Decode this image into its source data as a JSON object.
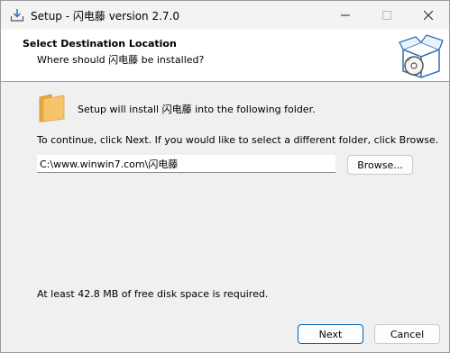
{
  "window": {
    "title": "Setup - 闪电藤 version 2.7.0"
  },
  "header": {
    "title": "Select Destination Location",
    "subtitle": "Where should 闪电藤 be installed?"
  },
  "body": {
    "intro": "Setup will install 闪电藤 into the following folder.",
    "instruction": "To continue, click Next. If you would like to select a different folder, click Browse.",
    "path_value": "C:\\www.winwin7.com\\闪电藤",
    "browse_label": "Browse...",
    "disk_space": "At least 42.8 MB of free disk space is required."
  },
  "footer": {
    "next_label": "Next",
    "cancel_label": "Cancel"
  },
  "colors": {
    "accent": "#005fb8",
    "folder": "#f6c56a",
    "header_bg": "#ffffff"
  },
  "icons": [
    "setup-icon",
    "minimize-icon",
    "maximize-icon",
    "close-icon",
    "install-box-icon",
    "folder-icon"
  ]
}
